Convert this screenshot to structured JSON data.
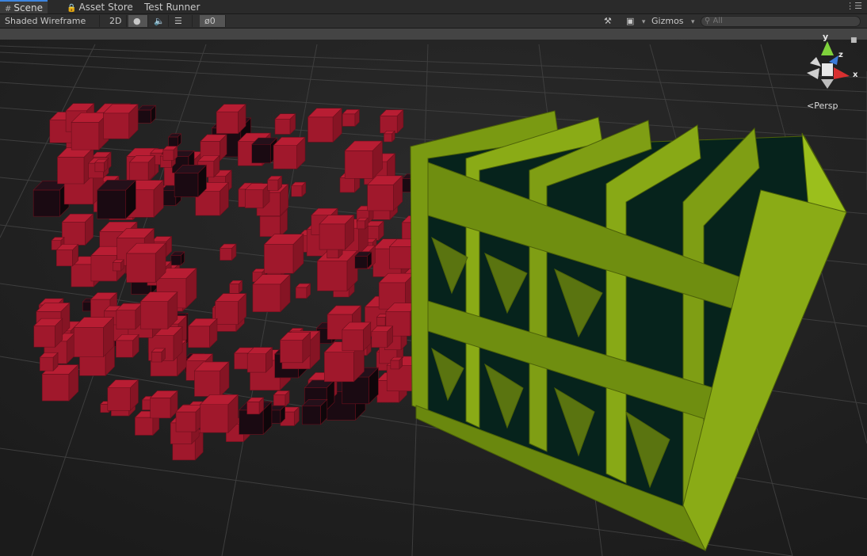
{
  "tabs": [
    {
      "label": "Scene",
      "icon": "grid-icon",
      "active": true
    },
    {
      "label": "Asset Store",
      "icon": "bag-icon",
      "active": false
    },
    {
      "label": "Test Runner",
      "icon": "",
      "active": false
    }
  ],
  "toolbar": {
    "shading_mode": "Shaded Wireframe",
    "mode_2d": "2D",
    "hidden_count": "0",
    "gizmos_label": "Gizmos",
    "search_placeholder": "All"
  },
  "scene_gizmo": {
    "axis_y": "y",
    "axis_z": "z",
    "axis_x": "x",
    "projection": "Persp"
  },
  "colors": {
    "cubes": "#a0182c",
    "lattice": "#6f8e10",
    "grid": "#3b3b3b",
    "tab_accent": "#3d85e0"
  }
}
